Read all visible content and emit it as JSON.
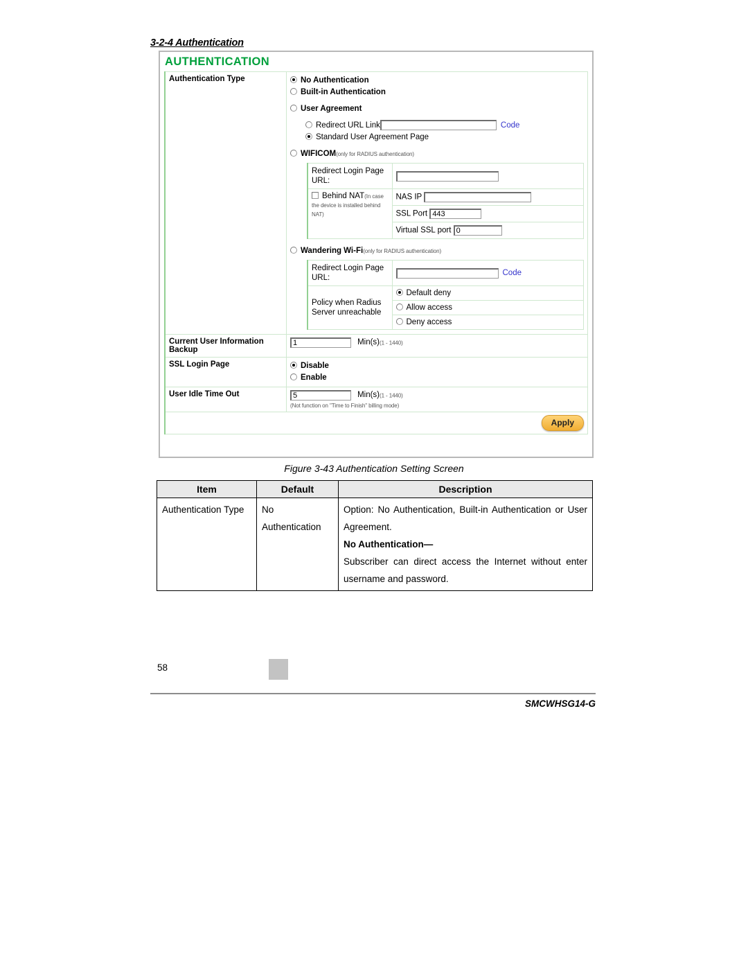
{
  "section_heading": "3-2-4 Authentication",
  "screen": {
    "title": "AUTHENTICATION",
    "auth_type_label": "Authentication Type",
    "options": {
      "no_auth": "No Authentication",
      "builtin": "Built-in Authentication",
      "user_agreement": "User Agreement",
      "redirect_url_link": "Redirect URL Link",
      "standard_page": "Standard User Agreement Page",
      "wificom": "WIFICOM",
      "wificom_hint": "(only for RADIUS authentication)",
      "wandering": "Wandering Wi-Fi",
      "wandering_hint": "(only for RADIUS authentication)"
    },
    "code_link": "Code",
    "redirect_url_value": "",
    "wificom": {
      "redirect_label": "Redirect Login Page URL:",
      "redirect_value": "",
      "behind_nat_label": "Behind NAT",
      "behind_nat_hint": "(In case the device is installed behind NAT)",
      "nas_ip_label": "NAS IP",
      "nas_ip_value": "",
      "ssl_port_label": "SSL Port",
      "ssl_port_value": "443",
      "virtual_ssl_label": "Virtual SSL port",
      "virtual_ssl_value": "0"
    },
    "wandering": {
      "redirect_label": "Redirect Login Page URL:",
      "redirect_value": "",
      "code_link": "Code",
      "policy_label": "Policy when Radius Server unreachable",
      "policy_options": [
        "Default deny",
        "Allow access",
        "Deny access"
      ],
      "policy_selected": "Default deny"
    },
    "backup": {
      "label": "Current User Information Backup",
      "value": "1",
      "unit": "Min(s)",
      "range": "(1 - 1440)"
    },
    "ssl_login": {
      "label": "SSL Login Page",
      "options": [
        "Disable",
        "Enable"
      ],
      "selected": "Disable"
    },
    "idle": {
      "label": "User Idle Time Out",
      "value": "5",
      "unit": "Min(s)",
      "range": "(1 - 1440)",
      "note": "(Not function on \"Time to Finish\" billing mode)"
    },
    "apply_label": "Apply"
  },
  "figure_caption": "Figure 3-43 Authentication Setting Screen",
  "desc_table": {
    "headers": [
      "Item",
      "Default",
      "Description"
    ],
    "rows": [
      {
        "item": "Authentication Type",
        "default": "No Authentication",
        "desc_line1": "Option: No Authentication, Built-in Authentication or User Agreement.",
        "desc_bold": "No Authentication—",
        "desc_line2": "Subscriber can direct access the Internet without enter username and password."
      }
    ]
  },
  "footer": {
    "page_number": "58",
    "model": "SMCWHSG14-G"
  },
  "colors": {
    "title_green": "#00a03c",
    "border_green": "#cfe8cf",
    "link_blue": "#3333cc",
    "apply_orange": "#f0ad33"
  }
}
